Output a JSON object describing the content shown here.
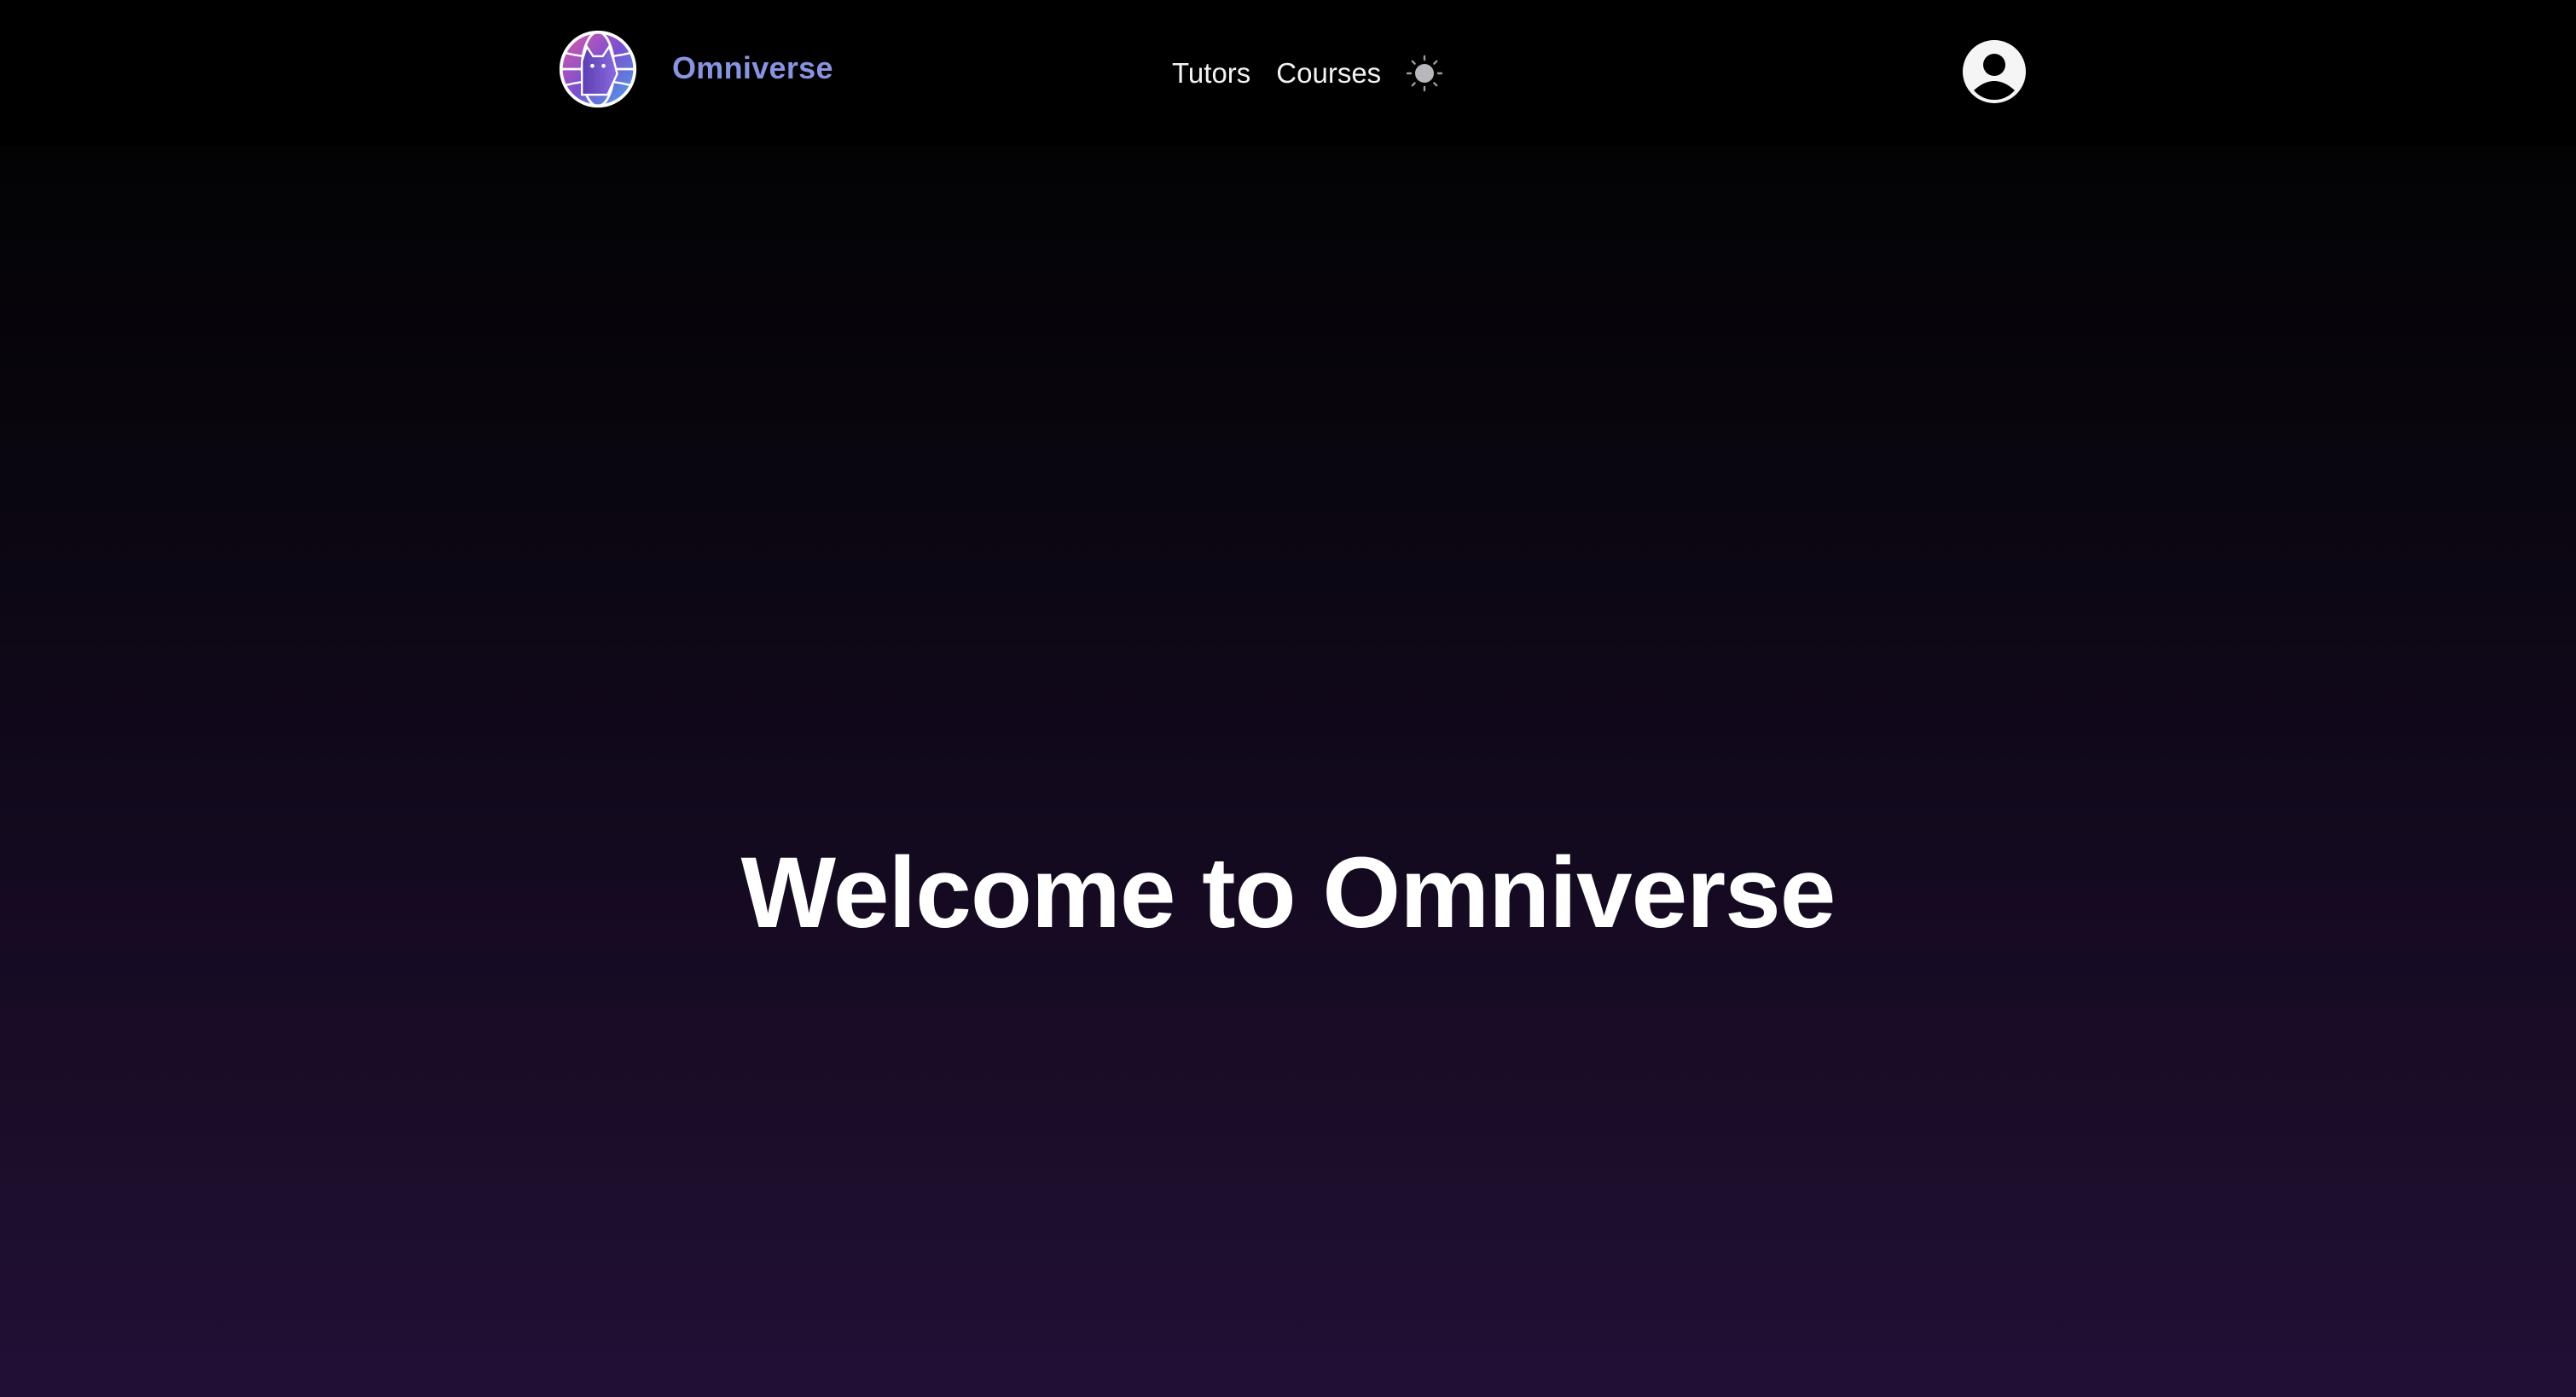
{
  "header": {
    "brand": "Omniverse",
    "brand_color": "#8894e0",
    "logo_icon": "wolf-globe-logo-icon",
    "nav": [
      {
        "label": "Tutors"
      },
      {
        "label": "Courses"
      }
    ],
    "theme_toggle_icon": "sun-icon",
    "account_icon": "user-circle-icon"
  },
  "hero": {
    "title": "Welcome to Omniverse"
  },
  "colors": {
    "background_top": "#000000",
    "background_bottom": "#220f36",
    "text": "#ffffff"
  }
}
